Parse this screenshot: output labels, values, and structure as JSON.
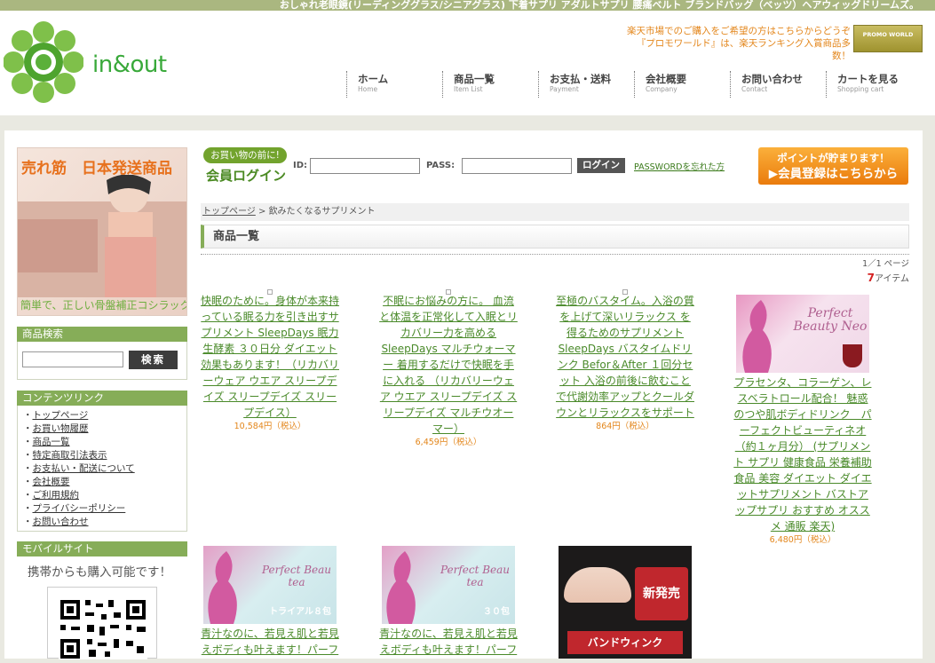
{
  "topbar": {
    "text": "おしゃれ老眼鏡(リーディンググラス/シニアグラス) 下着サプリ アダルトサプリ 腰痛ベルト ブランドバッグ（ベッツ）ヘアウィッグドリームズ。"
  },
  "header": {
    "logo_text": "in&out",
    "promo_line1": "楽天市場でのご購入をご希望の方はこちらからどうぞ",
    "promo_line2": "『プロモワールド』は、楽天ランキング入賞商品多数！",
    "promo_badge": "PROMO WORLD"
  },
  "nav": [
    {
      "jp": "ホーム",
      "en": "Home"
    },
    {
      "jp": "商品一覧",
      "en": "Item List"
    },
    {
      "jp": "お支払・送料",
      "en": "Payment"
    },
    {
      "jp": "会社概要",
      "en": "Company"
    },
    {
      "jp": "お問い合わせ",
      "en": "Contact"
    },
    {
      "jp": "カートを見る",
      "en": "Shopping cart"
    }
  ],
  "sidebar": {
    "banner_title": "売れ筋　日本発送商品",
    "banner_sub": "簡単で、正しい骨盤補正コシラック",
    "search_title": "商品検索",
    "search_button": "検索",
    "links_title": "コンテンツリンク",
    "links": [
      "トップページ",
      "お買い物履歴",
      "商品一覧",
      "特定商取引法表示",
      "お支払い・配送について",
      "会社概要",
      "ご利用規約",
      "プライバシーポリシー",
      "お問い合わせ"
    ],
    "mobile_title": "モバイルサイト",
    "mobile_text": "携帯からも購入可能です！"
  },
  "login": {
    "badge": "お買い物の前に!",
    "title": "会員ログイン",
    "id_label": "ID:",
    "pass_label": "PASS:",
    "button": "ログイン",
    "forgot": "PASSWORDを忘れた方",
    "register_line1": "ポイントが貯まります！",
    "register_line2": "▶会員登録はこちらから"
  },
  "breadcrumb": {
    "home": "トップページ",
    "sep": " > ",
    "current": "飲みたくなるサプリメント"
  },
  "list": {
    "heading": "商品一覧",
    "pages": "1／1 ページ",
    "count_num": "7",
    "count_label": "アイテム"
  },
  "products": [
    {
      "desc": "快眠のために。身体が本来持っている眠る力を引き出すサプリメント SleepDays 眠力生酵素 ３０日分 ダイエット効果もあります！（リカバリーウェア ウエア スリープデイズ スリープデイズ スリープデイス）",
      "price": "10,584円（税込）"
    },
    {
      "desc": "不眠にお悩みの方に。 血流と体温を正常化して入眠とリカバリー力を高める SleepDays マルチウォーマー 着用するだけで快眠を手に入れる （リカバリーウェア ウエア スリープデイズ スリープデイズ マルチウオーマー）",
      "price": "6,459円（税込）"
    },
    {
      "desc": "至極のバスタイム。入浴の質を上げて深いリラックス を得るためのサプリメント SleepDays バスタイムドリンク Befor＆After １回分セット 入浴の前後に飲むことで代謝効率アップとクールダウンとリラックスをサポート",
      "price": "864円（税込）"
    },
    {
      "desc": "プラセンタ、コラーゲン、レスベラトロール配合！ 魅惑のつや肌ボディドリンク　パーフェクトビューティネオ（約１ヶ月分） (サプリメント サプリ 健康食品 栄養補助食品 美容 ダイエット ダイエットサプリメント バストアップサプリ おすすめ オススメ 通販 楽天)",
      "price": "6,480円（税込）",
      "img_label": "Perfect Beauty Neo"
    },
    {
      "desc": "青汁なのに、若見え肌と若見えボディも叶えます！パーフ",
      "img_label": "Perfect Beau tea",
      "img_tag": "トライアル８包"
    },
    {
      "desc": "青汁なのに、若見え肌と若見えボディも叶えます！パーフ",
      "img_label": "Perfect Beau tea",
      "img_tag": "３０包"
    },
    {
      "img_label": "新発売",
      "img_tag": "バンドウィンク"
    }
  ]
}
